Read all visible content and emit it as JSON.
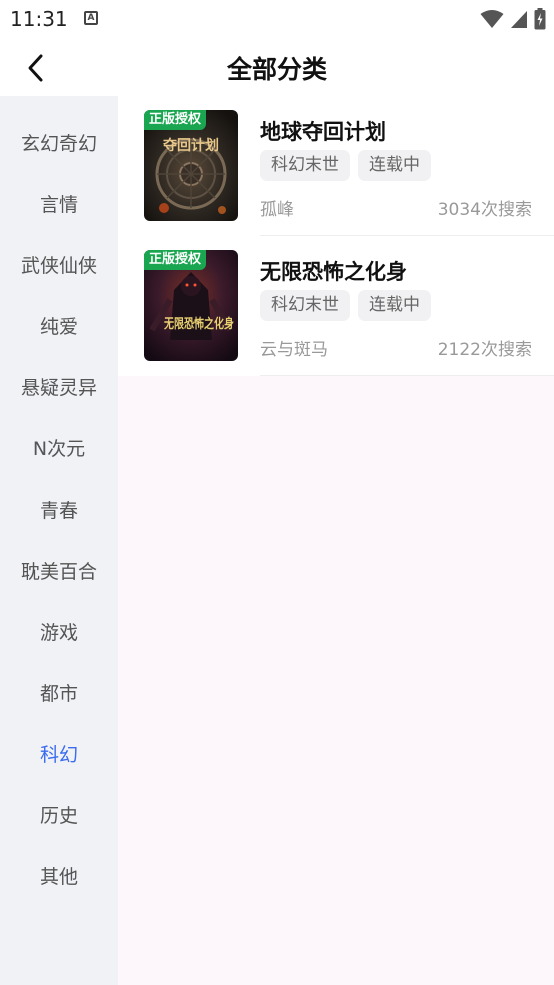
{
  "status_bar": {
    "time": "11:31",
    "notification_icon": "a-box-icon",
    "icons": [
      "wifi-icon",
      "signal-icon",
      "battery-icon"
    ]
  },
  "header": {
    "back_icon": "chevron-left-icon",
    "title": "全部分类"
  },
  "sidebar": {
    "active_index": 10,
    "active_color": "#3b6cf0",
    "items": [
      {
        "label": "玄幻奇幻"
      },
      {
        "label": "言情"
      },
      {
        "label": "武侠仙侠"
      },
      {
        "label": "纯爱"
      },
      {
        "label": "悬疑灵异"
      },
      {
        "label": "N次元"
      },
      {
        "label": "青春"
      },
      {
        "label": "耽美百合"
      },
      {
        "label": "游戏"
      },
      {
        "label": "都市"
      },
      {
        "label": "科幻"
      },
      {
        "label": "历史"
      },
      {
        "label": "其他"
      }
    ]
  },
  "books": [
    {
      "badge": "正版授权",
      "cover_text": "夺回计划",
      "title": "地球夺回计划",
      "tags": [
        "科幻末世",
        "连载中"
      ],
      "author": "孤峰",
      "count": "3034次搜索"
    },
    {
      "badge": "正版授权",
      "cover_text": "无限恐怖之化身",
      "title": "无限恐怖之化身",
      "tags": [
        "科幻末世",
        "连载中"
      ],
      "author": "云与斑马",
      "count": "2122次搜索"
    }
  ]
}
